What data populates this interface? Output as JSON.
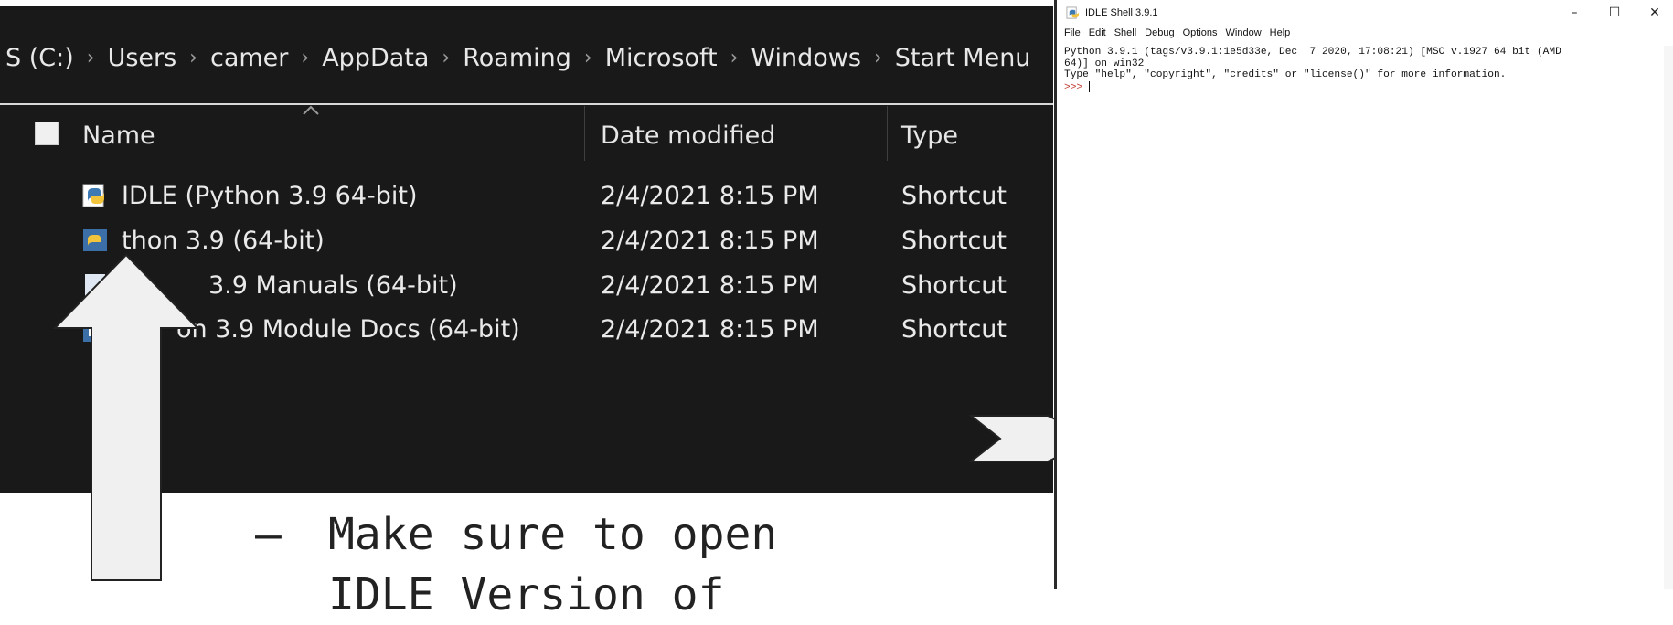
{
  "explorer": {
    "breadcrumb": [
      "S (C:)",
      "Users",
      "camer",
      "AppData",
      "Roaming",
      "Microsoft",
      "Windows",
      "Start Menu"
    ],
    "breadcrumb_separator": "›",
    "columns": {
      "name": "Name",
      "date_modified": "Date modified",
      "type": "Type"
    },
    "files": [
      {
        "name": "IDLE (Python 3.9 64-bit)",
        "date": "2/4/2021 8:15 PM",
        "type": "Shortcut",
        "icon": "idle-icon"
      },
      {
        "name": "thon 3.9 (64-bit)",
        "date": "2/4/2021 8:15 PM",
        "type": "Shortcut",
        "icon": "python-icon"
      },
      {
        "name": "3.9 Manuals (64-bit)",
        "date": "2/4/2021 8:15 PM",
        "type": "Shortcut",
        "icon": "manual-icon"
      },
      {
        "name": "on 3.9 Module Docs (64-bit)",
        "date": "2/4/2021 8:15 PM",
        "type": "Shortcut",
        "icon": "docs-icon"
      }
    ]
  },
  "annotation": {
    "dash": "–",
    "line1": "Make sure to open",
    "line2": "IDLE Version of"
  },
  "idle": {
    "title": "IDLE Shell 3.9.1",
    "controls": {
      "minimize": "–",
      "maximize": "☐",
      "close": "✕"
    },
    "menu": [
      "File",
      "Edit",
      "Shell",
      "Debug",
      "Options",
      "Window",
      "Help"
    ],
    "shell_lines": [
      "Python 3.9.1 (tags/v3.9.1:1e5d33e, Dec  7 2020, 17:08:21) [MSC v.1927 64 bit (AMD",
      "64)] on win32",
      "Type \"help\", \"copyright\", \"credits\" or \"license()\" for more information."
    ],
    "prompt": ">>> "
  },
  "colors": {
    "explorer_bg": "#191919",
    "arrow_fill": "#f0f0f0",
    "prompt": "#c0392b"
  }
}
